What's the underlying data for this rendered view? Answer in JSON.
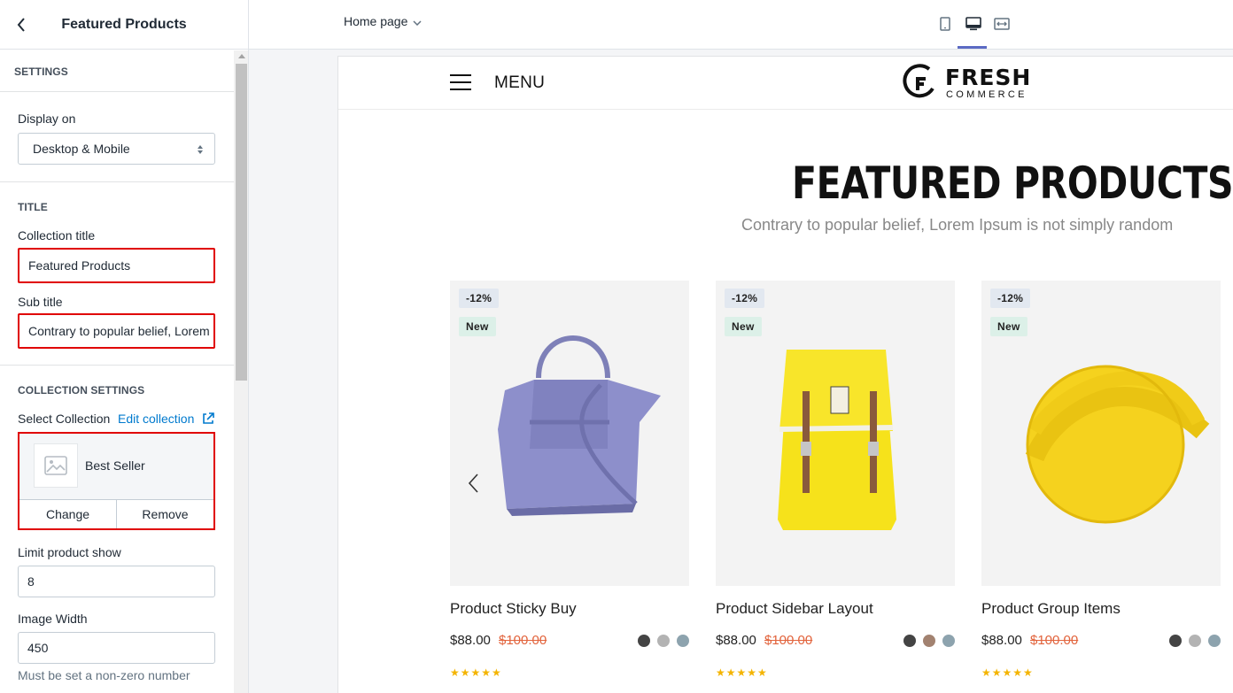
{
  "sidebar": {
    "title": "Featured Products",
    "settings_label": "SETTINGS",
    "display_on": {
      "label": "Display on",
      "value": "Desktop & Mobile"
    },
    "title_section": {
      "heading": "TITLE",
      "collection_title_label": "Collection title",
      "collection_title_value": "Featured Products",
      "subtitle_label": "Sub title",
      "subtitle_value": "Contrary to popular belief, Lorem Ipsum is not simply random"
    },
    "collection_settings": {
      "heading": "COLLECTION SETTINGS",
      "select_label": "Select Collection",
      "edit_link": "Edit collection",
      "collection_name": "Best Seller",
      "change_label": "Change",
      "remove_label": "Remove",
      "limit_label": "Limit product show",
      "limit_value": "8",
      "image_width_label": "Image Width",
      "image_width_value": "450",
      "image_width_help": "Must be set a non-zero number"
    }
  },
  "topbar": {
    "page_selector": "Home page",
    "views": [
      "mobile-view-icon",
      "desktop-view-icon",
      "fullwidth-view-icon"
    ],
    "active_view": "desktop"
  },
  "store": {
    "menu_label": "MENU",
    "logo_brand": "FRESH",
    "logo_sub": "COMMERCE",
    "section_title": "FEATURED PRODUCTS",
    "section_subtitle": "Contrary to popular belief, Lorem Ipsum is not simply random",
    "products": [
      {
        "badge_sale": "-12%",
        "badge_new": "New",
        "title": "Product Sticky Buy",
        "price": "$88.00",
        "compare_price": "$100.00",
        "swatches": [
          "#444444",
          "#b3b3b3",
          "#8da3ae"
        ],
        "rating": "★★★★★"
      },
      {
        "badge_sale": "-12%",
        "badge_new": "New",
        "title": "Product Sidebar Layout",
        "price": "$88.00",
        "compare_price": "$100.00",
        "swatches": [
          "#444444",
          "#a28270",
          "#8da3ae"
        ],
        "rating": "★★★★★"
      },
      {
        "badge_sale": "-12%",
        "badge_new": "New",
        "title": "Product Group Items",
        "price": "$88.00",
        "compare_price": "$100.00",
        "swatches": [
          "#444444",
          "#b3b3b3",
          "#8da3ae"
        ],
        "rating": "★★★★★"
      }
    ]
  },
  "colors": {
    "accent": "#5c6ac4",
    "link": "#007ace",
    "highlight": "#e00000",
    "sale_price": "#e2643d",
    "star": "#f4b400"
  }
}
